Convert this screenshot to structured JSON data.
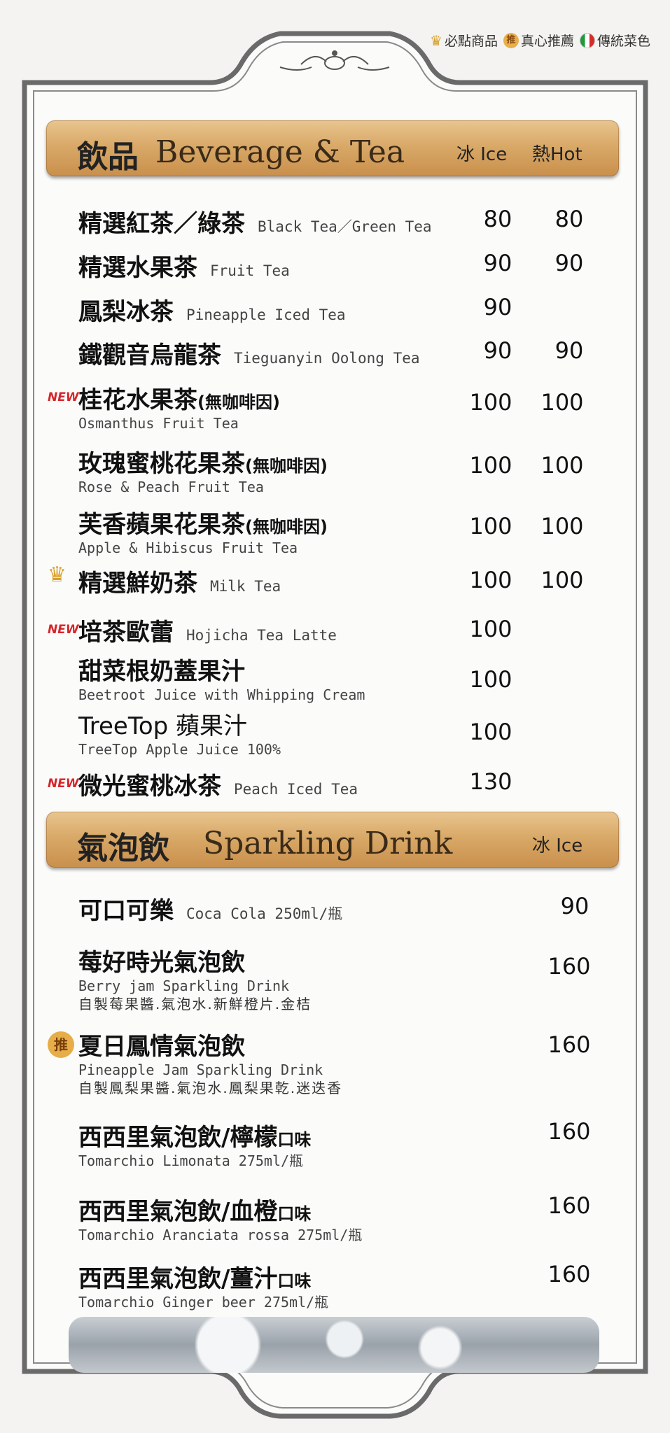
{
  "legend": {
    "must": "必點商品",
    "recommend": "真心推薦",
    "recommend_icon": "推",
    "traditional": "傳統菜色"
  },
  "beverage": {
    "title_cn": "飲品",
    "title_en": "Beverage & Tea",
    "col_ice": "冰 Ice",
    "col_hot": "熱Hot",
    "items": [
      {
        "cn": "精選紅茶／綠茶",
        "en": "Black Tea／Green Tea",
        "ice": "80",
        "hot": "80"
      },
      {
        "cn": "精選水果茶",
        "en": "Fruit Tea",
        "ice": "90",
        "hot": "90"
      },
      {
        "cn": "鳳梨冰茶",
        "en": "Pineapple Iced Tea",
        "ice": "90",
        "hot": ""
      },
      {
        "cn": "鐵觀音烏龍茶",
        "en": "Tieguanyin Oolong Tea",
        "ice": "90",
        "hot": "90"
      },
      {
        "cn": "桂花水果茶",
        "note": "(無咖啡因)",
        "en": "Osmanthus Fruit Tea",
        "ice": "100",
        "hot": "100",
        "badge": "NEW"
      },
      {
        "cn": "玫瑰蜜桃花果茶",
        "note": "(無咖啡因)",
        "en": "Rose & Peach Fruit Tea",
        "ice": "100",
        "hot": "100"
      },
      {
        "cn": "芙香蘋果花果茶",
        "note": "(無咖啡因)",
        "en": "Apple & Hibiscus Fruit Tea",
        "ice": "100",
        "hot": "100"
      },
      {
        "cn": "精選鮮奶茶",
        "en": "Milk Tea",
        "ice": "100",
        "hot": "100",
        "badge": "crown"
      },
      {
        "cn": "培茶歐蕾",
        "en": "Hojicha Tea Latte",
        "ice": "100",
        "hot": "",
        "badge": "NEW"
      },
      {
        "cn": "甜菜根奶蓋果汁",
        "en": "Beetroot Juice with Whipping Cream",
        "ice": "100",
        "hot": ""
      },
      {
        "cn": "TreeTop 蘋果汁",
        "en": "TreeTop Apple Juice 100%",
        "ice": "100",
        "hot": ""
      },
      {
        "cn": "微光蜜桃冰茶",
        "en": "Peach Iced Tea",
        "ice": "130",
        "hot": "",
        "badge": "NEW"
      }
    ]
  },
  "sparkling": {
    "title_cn": "氣泡飲",
    "title_en": "Sparkling Drink",
    "col_ice": "冰 Ice",
    "items": [
      {
        "cn": "可口可樂",
        "en": "Coca Cola 250ml/瓶",
        "price": "90"
      },
      {
        "cn": "莓好時光氣泡飲",
        "en": "Berry jam Sparkling Drink",
        "desc": "自製莓果醬.氣泡水.新鮮橙片.金桔",
        "price": "160"
      },
      {
        "cn": "夏日鳳情氣泡飲",
        "en": "Pineapple Jam Sparkling Drink",
        "desc": "自製鳳梨果醬.氣泡水.鳳梨果乾.迷迭香",
        "price": "160",
        "badge": "推"
      },
      {
        "cn": "西西里氣泡飲/檸檬",
        "note": "口味",
        "en": "Tomarchio Limonata 275ml/瓶",
        "price": "160"
      },
      {
        "cn": "西西里氣泡飲/血橙",
        "note": "口味",
        "en": "Tomarchio Aranciata rossa 275ml/瓶",
        "price": "160"
      },
      {
        "cn": "西西里氣泡飲/薑汁",
        "note": "口味",
        "en": "Tomarchio Ginger beer 275ml/瓶",
        "price": "160"
      }
    ]
  }
}
